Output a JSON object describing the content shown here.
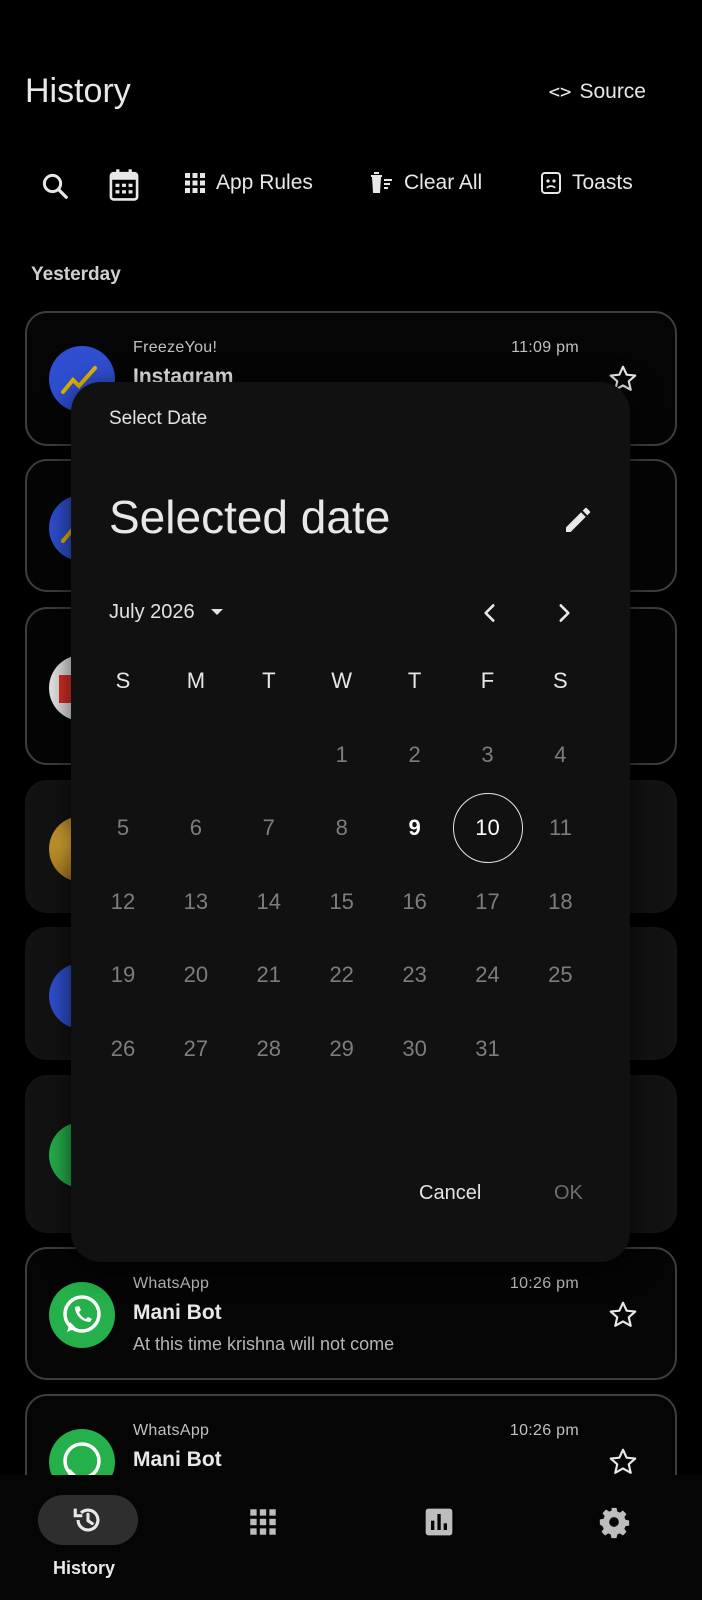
{
  "header": {
    "title": "History",
    "source_icon": "code-icon",
    "source_label": "Source"
  },
  "toolbar": {
    "search_icon": "search-icon",
    "calendar_icon": "calendar-icon",
    "app_rules_label": "App Rules",
    "clear_all_label": "Clear All",
    "toasts_label": "Toasts"
  },
  "section_label": "Yesterday",
  "notifications": [
    {
      "app": "FreezeYou!",
      "time": "11:09 pm",
      "title": "Instagram",
      "body": "",
      "icon": "freezeyou-icon"
    },
    {
      "app": "",
      "time": "",
      "title": "",
      "body": "",
      "icon": "freezeyou-icon"
    },
    {
      "app": "",
      "time": "",
      "title": "",
      "body": "",
      "icon": "gmail-icon"
    },
    {
      "app": "",
      "time": "",
      "title": "",
      "body": "",
      "icon": "avatar-photo"
    },
    {
      "app": "",
      "time": "",
      "title": "",
      "body": "",
      "icon": "freezeyou-icon"
    },
    {
      "app": "",
      "time": "",
      "title": "",
      "body": "",
      "icon": "whatsapp-icon"
    },
    {
      "app": "WhatsApp",
      "time": "10:26 pm",
      "title": "Mani Bot",
      "body": "At this time krishna will not come",
      "icon": "whatsapp-icon"
    },
    {
      "app": "WhatsApp",
      "time": "10:26 pm",
      "title": "Mani Bot",
      "body": "",
      "icon": "whatsapp-icon"
    }
  ],
  "dialog": {
    "label": "Select Date",
    "headline": "Selected date",
    "month_label": "July 2026",
    "weekdays": [
      "S",
      "M",
      "T",
      "W",
      "T",
      "F",
      "S"
    ],
    "first_weekday_index": 3,
    "days_in_month": 31,
    "today": 9,
    "selected_day": 10,
    "cancel_label": "Cancel",
    "ok_label": "OK"
  },
  "nav": {
    "items": [
      {
        "icon": "history-icon",
        "label": "History",
        "active": true
      },
      {
        "icon": "apps-icon",
        "label": "",
        "active": false
      },
      {
        "icon": "stats-icon",
        "label": "",
        "active": false
      },
      {
        "icon": "settings-icon",
        "label": "",
        "active": false
      }
    ]
  },
  "colors": {
    "background": "#000000",
    "dialog": "#111111",
    "whatsapp": "#25b04b",
    "freezeyou": "#2f4fd0"
  }
}
